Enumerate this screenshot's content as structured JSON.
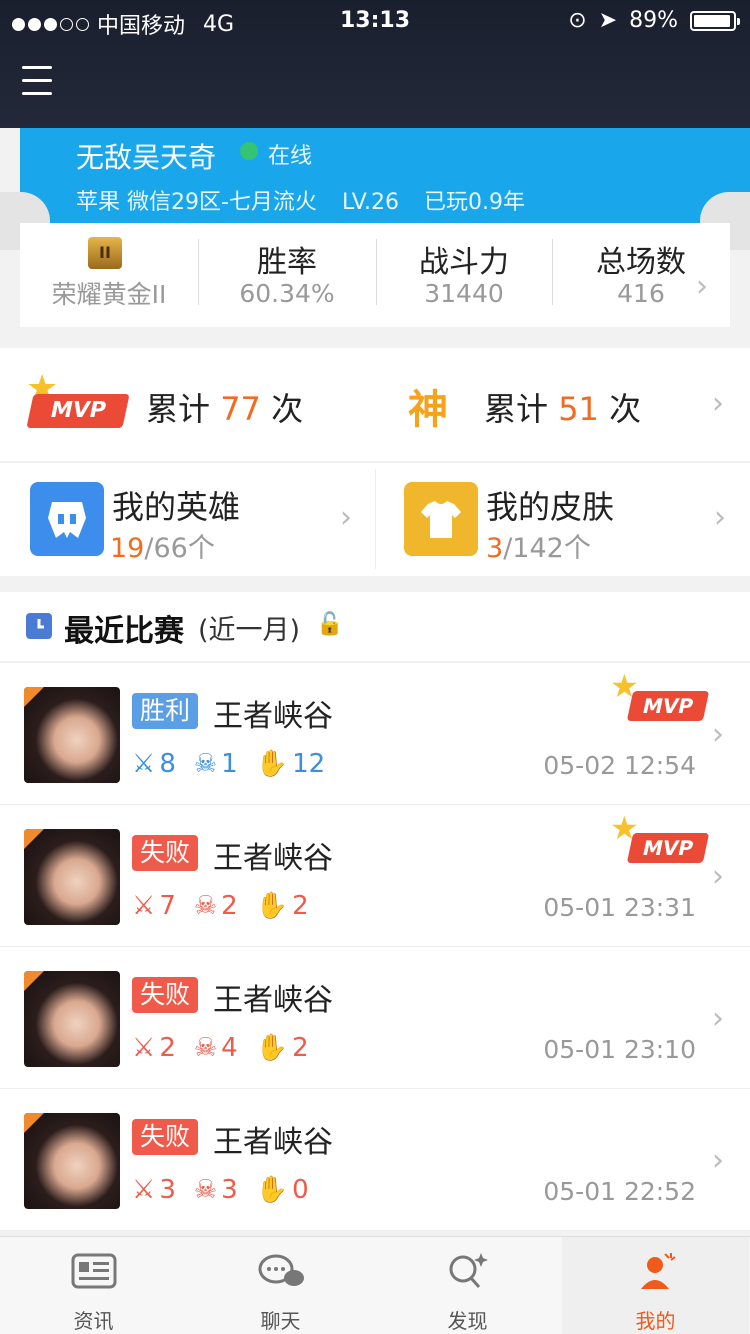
{
  "status_bar": {
    "carrier": "中国移动",
    "network": "4G",
    "time": "13:13",
    "battery": "89%"
  },
  "profile": {
    "name": "无敌吴天奇",
    "online_status": "在线",
    "server": "苹果 微信29区-七月流火",
    "level": "LV.26",
    "played": "已玩0.9年"
  },
  "stats": {
    "rank_label": "荣耀黄金II",
    "winrate_label": "胜率",
    "winrate_value": "60.34%",
    "power_label": "战斗力",
    "power_value": "31440",
    "games_label": "总场数",
    "games_value": "416"
  },
  "achievements": {
    "mvp_badge": "MVP",
    "mvp_prefix": "累计",
    "mvp_count": "77",
    "mvp_suffix": "次",
    "god_badge": "神",
    "god_prefix": "累计",
    "god_count": "51",
    "god_suffix": "次"
  },
  "collection": {
    "heroes_label": "我的英雄",
    "heroes_owned": "19",
    "heroes_total": "/66个",
    "skins_label": "我的皮肤",
    "skins_owned": "3",
    "skins_total": "/142个"
  },
  "recent": {
    "title": "最近比赛",
    "subtitle": "(近一月)"
  },
  "matches": [
    {
      "result": "胜利",
      "map": "王者峡谷",
      "kills": "8",
      "deaths": "1",
      "assists": "12",
      "time": "05-02 12:54",
      "mvp": "MVP"
    },
    {
      "result": "失败",
      "map": "王者峡谷",
      "kills": "7",
      "deaths": "2",
      "assists": "2",
      "time": "05-01 23:31",
      "mvp": "MVP"
    },
    {
      "result": "失败",
      "map": "王者峡谷",
      "kills": "2",
      "deaths": "4",
      "assists": "2",
      "time": "05-01 23:10"
    },
    {
      "result": "失败",
      "map": "王者峡谷",
      "kills": "3",
      "deaths": "3",
      "assists": "0",
      "time": "05-01 22:52"
    }
  ],
  "tabs": [
    {
      "label": "资讯"
    },
    {
      "label": "聊天"
    },
    {
      "label": "发现"
    },
    {
      "label": "我的"
    }
  ],
  "colors": {
    "accent": "#f26b1f",
    "profile_bg": "#1aa6eb",
    "win": "#5a9ee6",
    "lose": "#f05a4a"
  }
}
